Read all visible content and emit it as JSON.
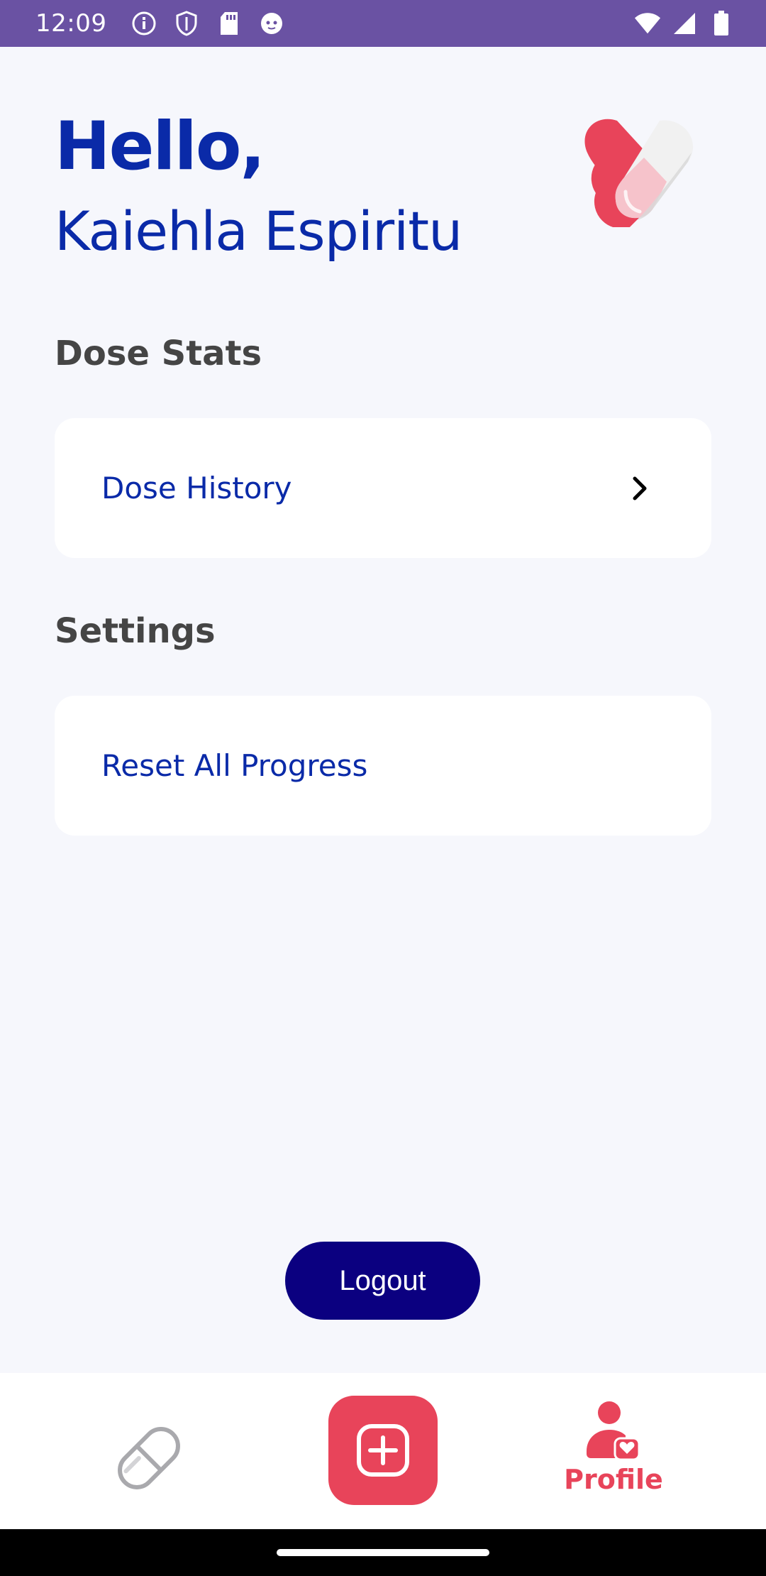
{
  "status_bar": {
    "time": "12:09",
    "icons_left": [
      "info-icon",
      "shield-icon",
      "sd-card-icon",
      "cat-icon"
    ],
    "icons_right": [
      "wifi-icon",
      "signal-icon",
      "battery-icon"
    ]
  },
  "greeting": {
    "hello": "Hello,",
    "name": "Kaiehla Espiritu"
  },
  "sections": {
    "dose_stats": {
      "title": "Dose Stats",
      "item_label": "Dose History"
    },
    "settings": {
      "title": "Settings",
      "item_label": "Reset All Progress"
    }
  },
  "logout_label": "Logout",
  "bottom_nav": {
    "items": [
      {
        "icon": "pill-icon",
        "label": ""
      },
      {
        "icon": "add-icon",
        "label": ""
      },
      {
        "icon": "profile-heart-icon",
        "label": "Profile"
      }
    ]
  },
  "colors": {
    "status_bar": "#6a52a3",
    "primary_blue": "#0a2aa8",
    "logout_navy": "#0b0080",
    "accent_red": "#e8445a",
    "background": "#f6f7fc"
  }
}
